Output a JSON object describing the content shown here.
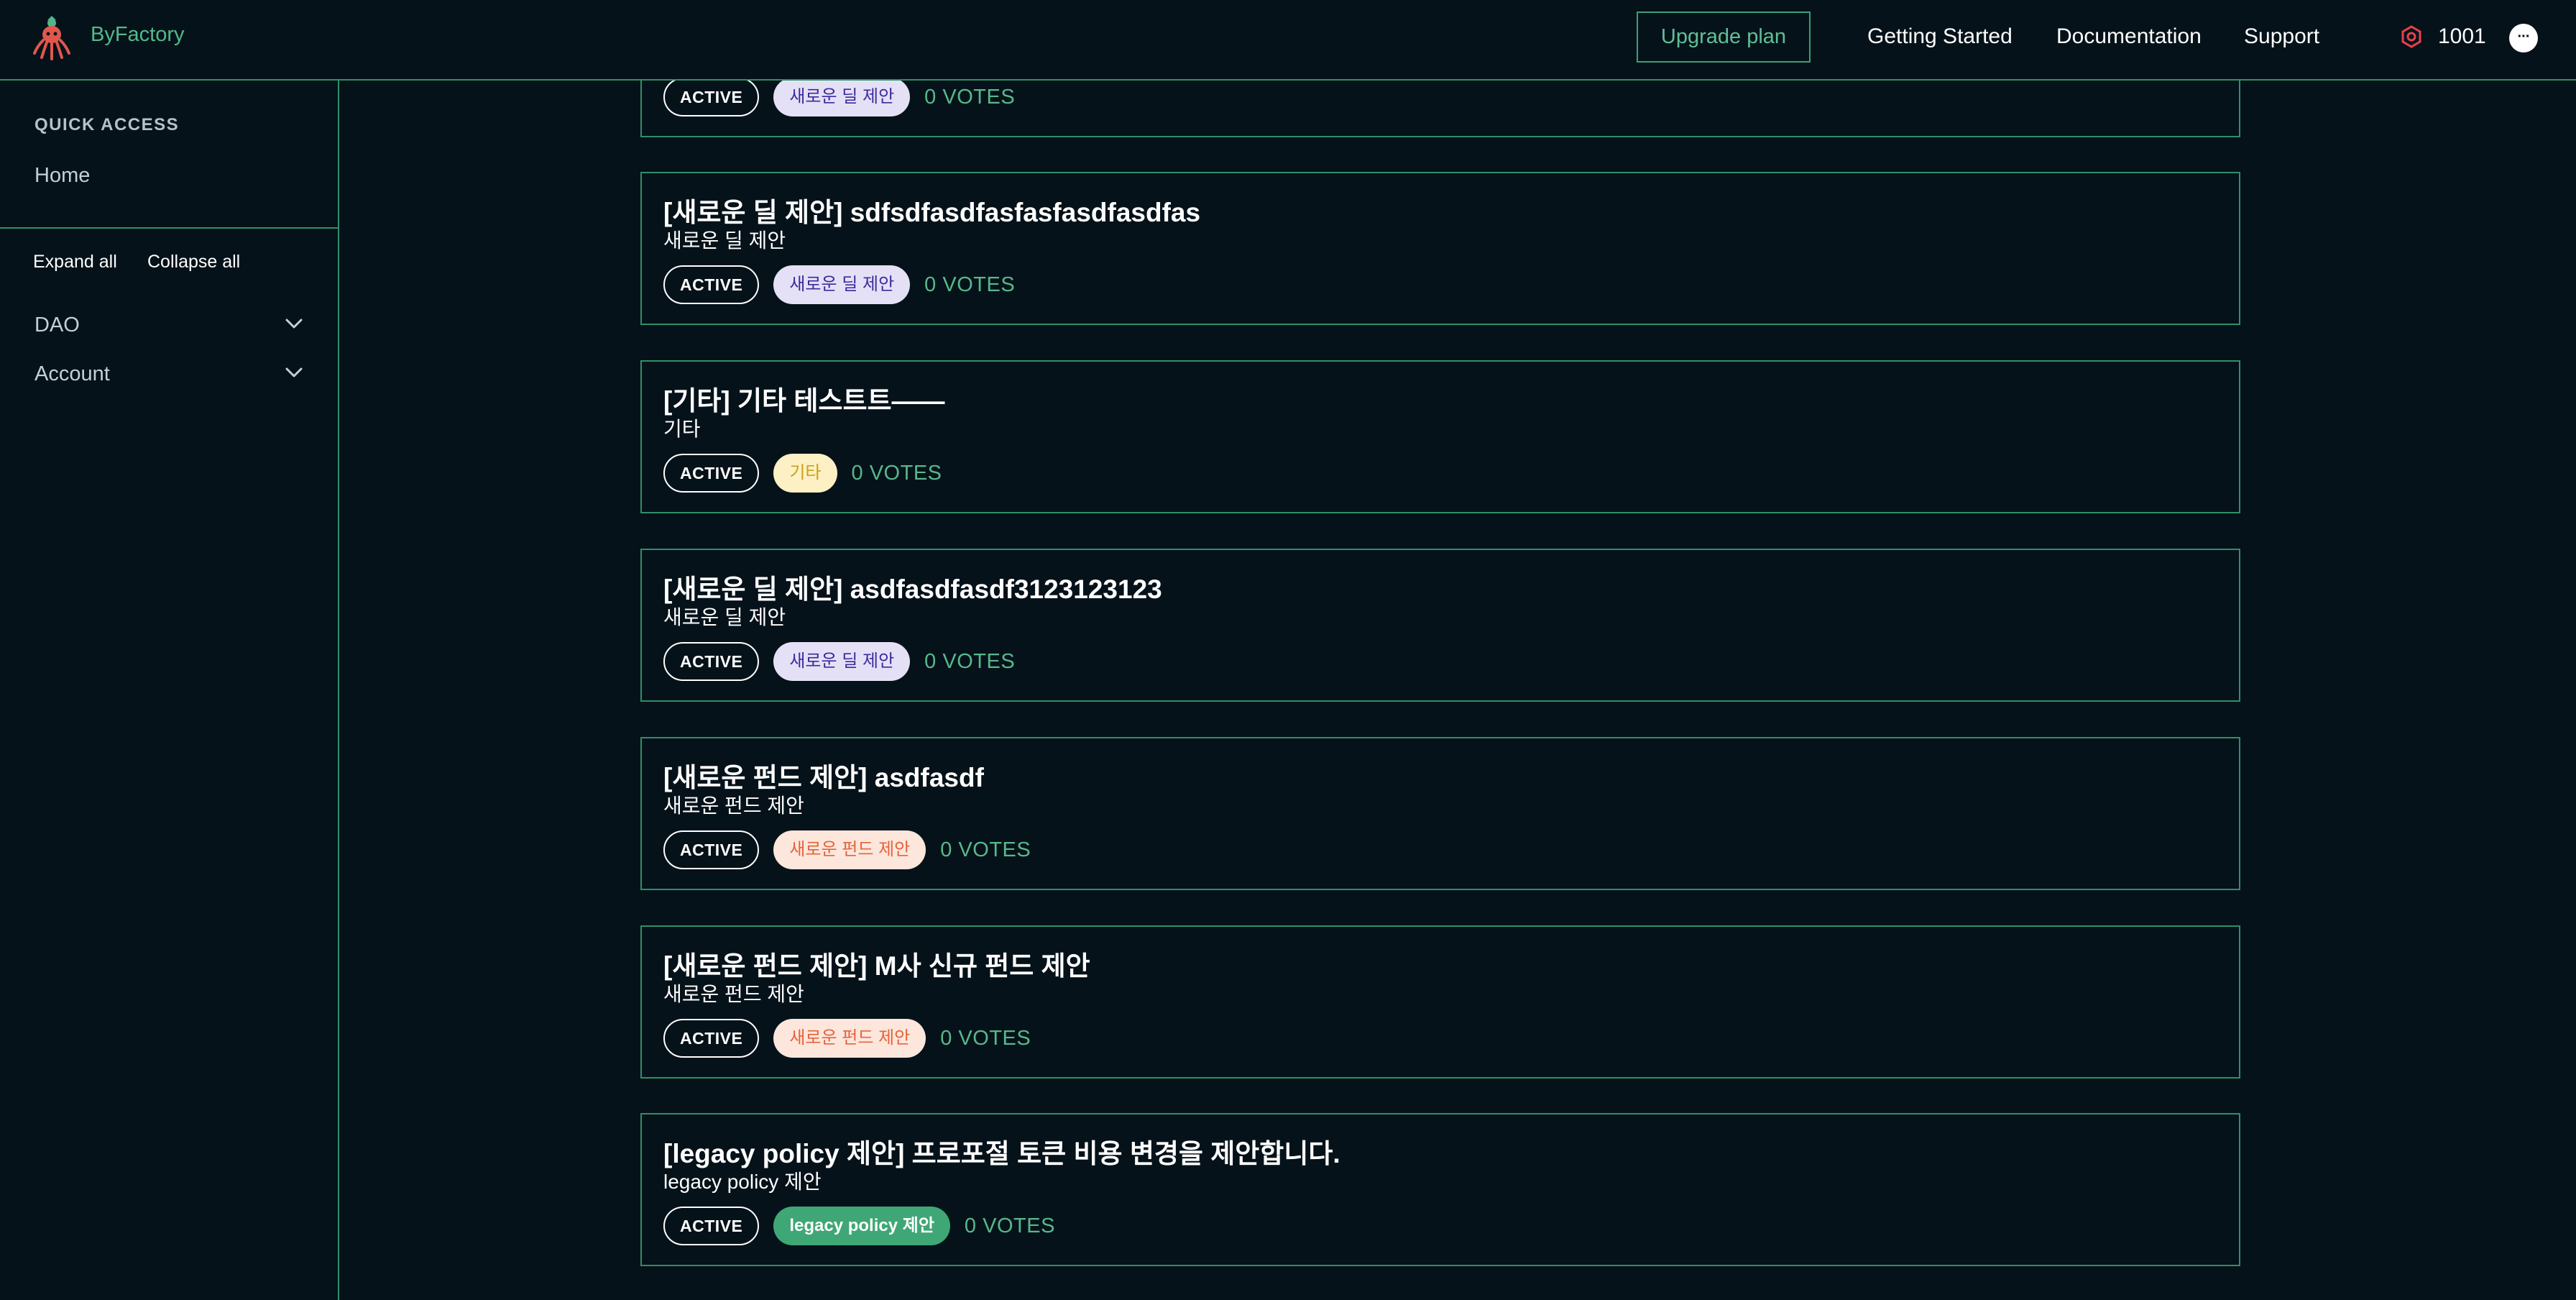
{
  "header": {
    "brand": "ByFactory",
    "upgrade_label": "Upgrade plan",
    "nav": [
      "Getting Started",
      "Documentation",
      "Support"
    ],
    "points": "1001",
    "avatar_glyph": "···"
  },
  "sidebar": {
    "quick_access_title": "QUICK ACCESS",
    "home_label": "Home",
    "expand_all": "Expand all",
    "collapse_all": "Collapse all",
    "groups": [
      "DAO",
      "Account"
    ]
  },
  "proposals": [
    {
      "title": "",
      "subtitle": "",
      "status": "ACTIVE",
      "category": "새로운 딜 제안",
      "category_style": "deal",
      "votes": "0 VOTES"
    },
    {
      "title": "[새로운 딜 제안] sdfsdfasdfasfasfasdfasdfas",
      "subtitle": "새로운 딜 제안",
      "status": "ACTIVE",
      "category": "새로운 딜 제안",
      "category_style": "deal",
      "votes": "0 VOTES"
    },
    {
      "title": "[기타] 기타 테스트트——",
      "subtitle": "기타",
      "status": "ACTIVE",
      "category": "기타",
      "category_style": "etc",
      "votes": "0 VOTES"
    },
    {
      "title": "[새로운 딜 제안] asdfasdfasdf3123123123",
      "subtitle": "새로운 딜 제안",
      "status": "ACTIVE",
      "category": "새로운 딜 제안",
      "category_style": "deal",
      "votes": "0 VOTES"
    },
    {
      "title": "[새로운 펀드 제안] asdfasdf",
      "subtitle": "새로운 펀드 제안",
      "status": "ACTIVE",
      "category": "새로운 펀드 제안",
      "category_style": "fund",
      "votes": "0 VOTES"
    },
    {
      "title": "[새로운 펀드 제안] M사 신규 펀드 제안",
      "subtitle": "새로운 펀드 제안",
      "status": "ACTIVE",
      "category": "새로운 펀드 제안",
      "category_style": "fund",
      "votes": "0 VOTES"
    },
    {
      "title": "[legacy policy 제안] 프로포절 토큰 비용 변경을 제안합니다.",
      "subtitle": "legacy policy 제안",
      "status": "ACTIVE",
      "category": "legacy policy 제안",
      "category_style": "legacy",
      "votes": "0 VOTES"
    }
  ],
  "colors": {
    "background": "#06121a",
    "accent": "#2f8f68",
    "brand": "#52b98a",
    "votes": "#58b88b"
  }
}
